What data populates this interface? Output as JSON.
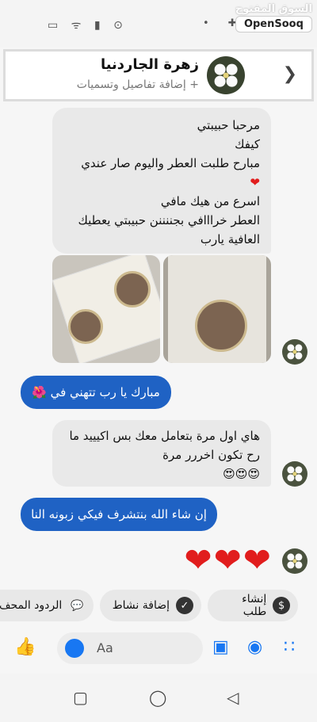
{
  "status_bar": {
    "left_icons": "▭ ᯤ ▮ ⊙",
    "right_icons": "• ✚ ▤"
  },
  "watermark": {
    "arabic": "السوق المفتوح",
    "brand": "OpenSooq"
  },
  "header": {
    "name": "زهرة الجاردنيا",
    "subtitle": "+ إضافة تفاصيل وتسميات",
    "back_icon": "chevron-left-icon"
  },
  "messages": {
    "incoming_1": [
      "مرحبا حبيبتي",
      "كيفك",
      "مبارح طلبت العطر واليوم صار عندي",
      "❤",
      "اسرع من هيك مافي",
      "العطر خرااافي بجننننن حبيبتي يعطيك",
      "العافية يارب"
    ],
    "outgoing_1": "مبارك يا رب تتهني في 🌺",
    "incoming_2": [
      "هاي اول مرة بتعامل معك بس اكيييد ما",
      "رح تكون اخررر مرة",
      "😍😍😍"
    ],
    "outgoing_2": "إن شاء الله بنتشرف فيكي زبونه النا",
    "hearts": "❤❤❤"
  },
  "quick_replies": [
    {
      "label": "إنشاء طلب",
      "icon": "$"
    },
    {
      "label": "إضافة نشاط",
      "icon": "✓"
    },
    {
      "label": "الردود المحف",
      "icon": "💬"
    }
  ],
  "composer": {
    "placeholder": "Aa"
  },
  "colors": {
    "outgoing_bubble": "#1f62c4",
    "incoming_bubble": "#e9e9e9",
    "accent": "#1877f2"
  }
}
